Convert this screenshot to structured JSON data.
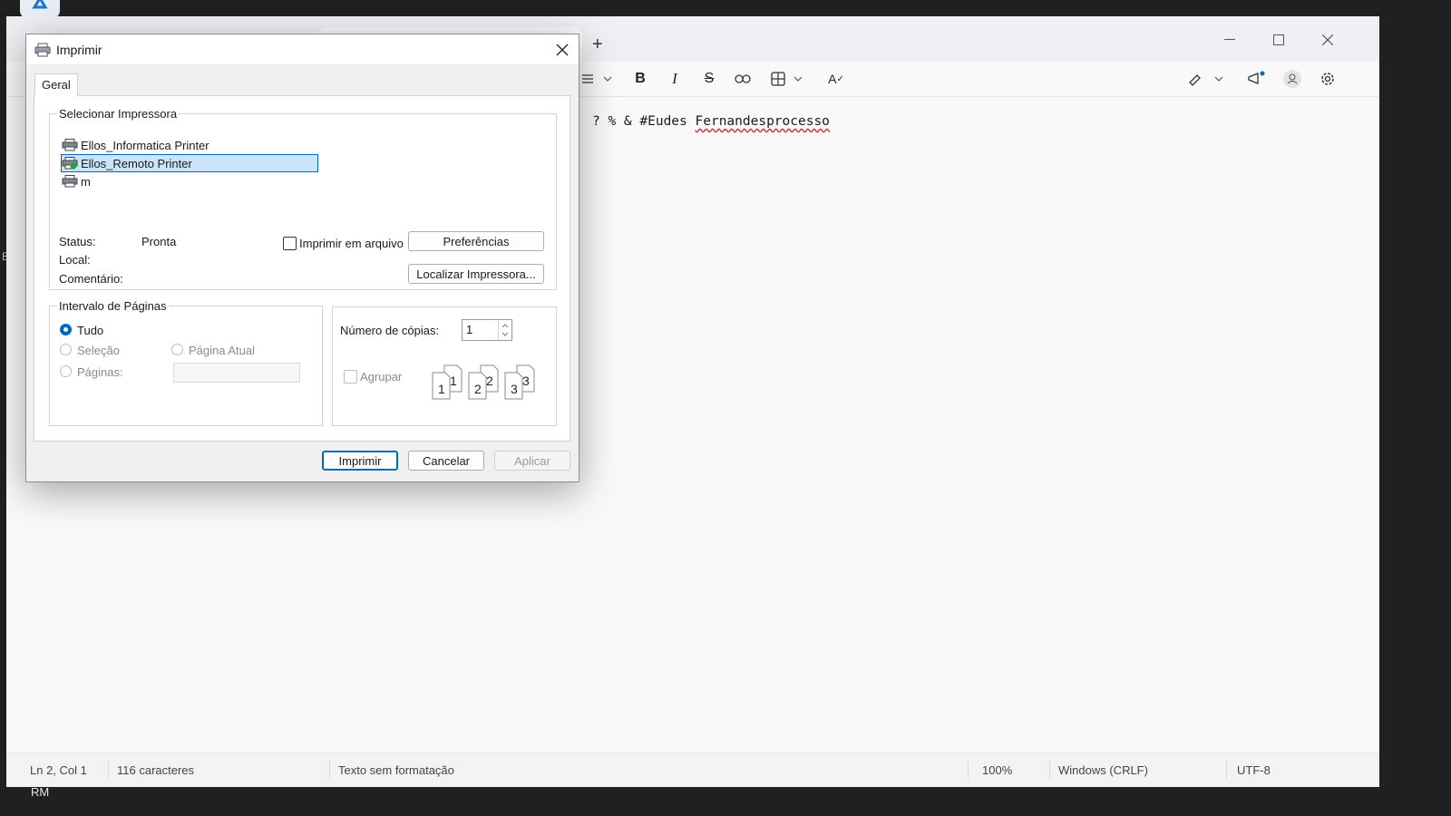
{
  "desktop": {
    "bottom_label": "RM"
  },
  "notepad": {
    "content_prefix": "? % & #Eudes ",
    "content_misspelled": "Fernandesprocesso",
    "status": {
      "position": "Ln 2, Col 1",
      "chars": "116 caracteres",
      "format": "Texto sem formatação",
      "zoom": "100%",
      "line_ending": "Windows (CRLF)",
      "encoding": "UTF-8"
    }
  },
  "dialog": {
    "title": "Imprimir",
    "tab": "Geral",
    "select_printer": {
      "legend": "Selecionar Impressora",
      "printers": [
        {
          "name": "Ellos_Informatica Printer",
          "selected": false
        },
        {
          "name": "Ellos_Remoto Printer",
          "selected": true
        },
        {
          "name": "m",
          "selected": false
        }
      ],
      "status_label": "Status:",
      "status_value": "Pronta",
      "location_label": "Local:",
      "comment_label": "Comentário:",
      "print_to_file": "Imprimir em arquivo",
      "preferences_button": "Preferências",
      "find_printer_button": "Localizar Impressora..."
    },
    "page_range": {
      "legend": "Intervalo de Páginas",
      "all": "Tudo",
      "selection": "Seleção",
      "current_page": "Página Atual",
      "pages": "Páginas:"
    },
    "copies": {
      "label": "Número de cópias:",
      "value": "1",
      "collate": "Agrupar"
    },
    "buttons": {
      "print": "Imprimir",
      "cancel": "Cancelar",
      "apply": "Aplicar"
    }
  }
}
